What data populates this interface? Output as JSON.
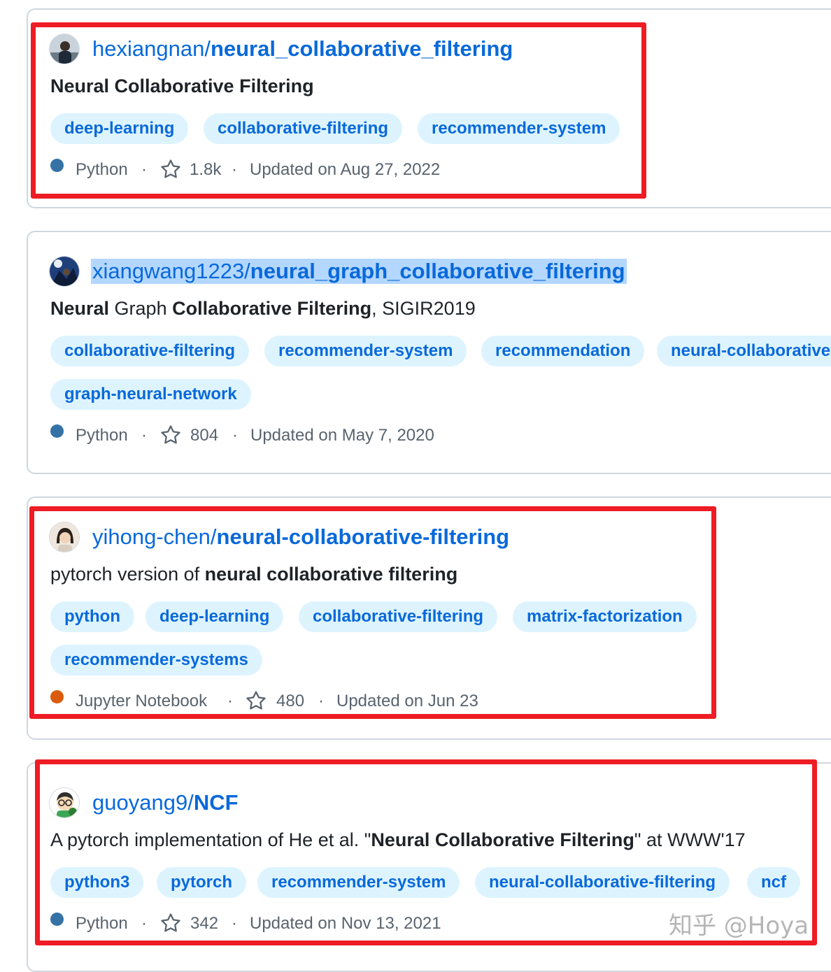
{
  "repos": [
    {
      "owner": "hexiangnan/",
      "repo": "neural_collaborative_filtering",
      "description_parts": [
        {
          "text": "Neural Collaborative Filtering",
          "bold": true
        }
      ],
      "topics": [
        "deep-learning",
        "collaborative-filtering",
        "recommender-system"
      ],
      "language": "Python",
      "language_color": "#3572A5",
      "stars": "1.8k",
      "updated": "Updated on Aug 27, 2022",
      "highlighted": true,
      "title_selected": false
    },
    {
      "owner": "xiangwang1223/",
      "repo": "neural_graph_collaborative_filtering",
      "description_parts": [
        {
          "text": "Neural",
          "bold": true
        },
        {
          "text": " Graph ",
          "bold": false
        },
        {
          "text": "Collaborative Filtering",
          "bold": true
        },
        {
          "text": ", SIGIR2019",
          "bold": false
        }
      ],
      "topics": [
        "collaborative-filtering",
        "recommender-system",
        "recommendation",
        "neural-collaborative",
        "graph-neural-network"
      ],
      "language": "Python",
      "language_color": "#3572A5",
      "stars": "804",
      "updated": "Updated on May 7, 2020",
      "highlighted": false,
      "title_selected": true
    },
    {
      "owner": "yihong-chen/",
      "repo": "neural-collaborative-filtering",
      "description_parts": [
        {
          "text": "pytorch version of ",
          "bold": false
        },
        {
          "text": "neural collaborative filtering",
          "bold": true
        }
      ],
      "topics": [
        "python",
        "deep-learning",
        "collaborative-filtering",
        "matrix-factorization",
        "recommender-systems"
      ],
      "language": "Jupyter Notebook",
      "language_color": "#DA5B0B",
      "stars": "480",
      "updated": "Updated on Jun 23",
      "highlighted": true,
      "title_selected": false
    },
    {
      "owner": "guoyang9/",
      "repo": "NCF",
      "description_parts": [
        {
          "text": "A pytorch implementation of He et al. \"",
          "bold": false
        },
        {
          "text": "Neural Collaborative Filtering",
          "bold": true
        },
        {
          "text": "\" at WWW'17",
          "bold": false
        }
      ],
      "topics": [
        "python3",
        "pytorch",
        "recommender-system",
        "neural-collaborative-filtering",
        "ncf"
      ],
      "language": "Python",
      "language_color": "#3572A5",
      "stars": "342",
      "updated": "Updated on Nov 13, 2021",
      "highlighted": true,
      "title_selected": false
    }
  ],
  "icons": {
    "star": "star-icon",
    "language": "language-dot-icon",
    "avatar": "avatar-icon"
  },
  "colors": {
    "link": "#0969da",
    "topic_bg": "#ddf4ff",
    "highlight_box": "#ee1c24",
    "selection": "#b3d7ff"
  },
  "watermark": "知乎 @Hoya"
}
